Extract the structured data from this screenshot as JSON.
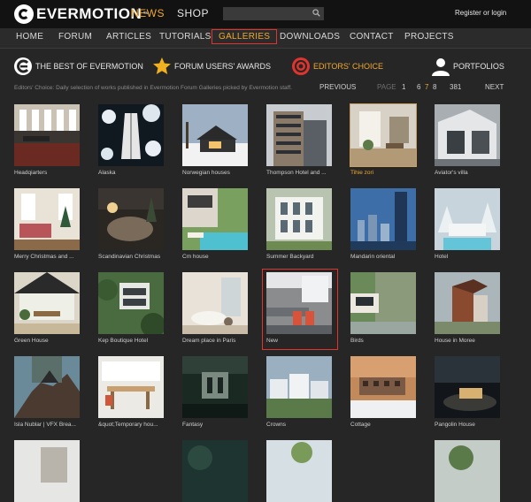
{
  "topbar": {
    "logo": "EVERMOTION",
    "logo_tm": "™",
    "news": "NEWS",
    "shop": "SHOP",
    "search_placeholder": "",
    "register": "Register or login"
  },
  "mainnav": {
    "items": [
      {
        "label": "HOME"
      },
      {
        "label": "FORUM"
      },
      {
        "label": "ARTICLES"
      },
      {
        "label": "TUTORIALS"
      },
      {
        "label": "GALLERIES"
      },
      {
        "label": "DOWNLOADS"
      },
      {
        "label": "CONTACT"
      },
      {
        "label": "PROJECTS"
      }
    ],
    "active": "GALLERIES"
  },
  "subnav": {
    "items": [
      {
        "label": "THE BEST OF EVERMOTION",
        "icon": "evermotion-logo-icon"
      },
      {
        "label": "FORUM USERS' AWARDS",
        "icon": "star-icon"
      },
      {
        "label": "EDITORS' CHOICE",
        "icon": "target-icon"
      },
      {
        "label": "PORTFOLIOS",
        "icon": "user-icon"
      }
    ]
  },
  "infobar": {
    "text": "Editors' Choice: Daily selection of works published in Evermotion Forum Galleries picked by Evermotion staff.",
    "previous": "PREVIOUS",
    "page_label": "PAGE",
    "pages": [
      "1",
      "6",
      "7",
      "8",
      "381"
    ],
    "current_page": "7",
    "next": "NEXT"
  },
  "gallery": {
    "rows": [
      [
        "Headqiarters",
        "Alaska",
        "Norwegian houses",
        "Thompson Hotel and ...",
        "Tihie zori",
        "Aviator's villa"
      ],
      [
        "Merry Christmas and ...",
        "Scandinavian Christmas",
        "Cm house",
        "Summer Backyard",
        "Mandarin oriental",
        "Hotel"
      ],
      [
        "Green House",
        "Kep Boutique Hotel",
        "Dream place in Paris",
        "New",
        "Birds",
        "House in Moree"
      ],
      [
        "Isla Nublar | VFX Brea...",
        "&quot;Temporary hou...",
        "Fantasy",
        "Crowns",
        "Cottage",
        "Pangolin House"
      ]
    ],
    "highlighted_caption": "Tihie zori",
    "selected": "New"
  },
  "colors": {
    "accent": "#f0a830",
    "highlight_red": "#e0342e",
    "background": "#262626",
    "topbar": "#121212"
  }
}
